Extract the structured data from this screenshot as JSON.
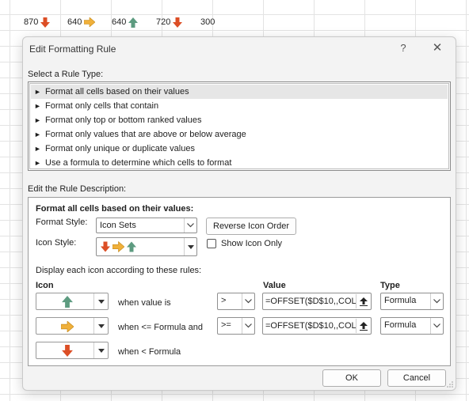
{
  "sheet": {
    "cells": [
      {
        "value": "870",
        "icon": "red-down-arrow-icon"
      },
      {
        "value": "640",
        "icon": "yellow-right-arrow-icon"
      },
      {
        "value": "640",
        "icon": "green-up-arrow-icon"
      },
      {
        "value": "720",
        "icon": "red-down-arrow-icon"
      },
      {
        "value": "300",
        "icon": ""
      }
    ]
  },
  "dialog": {
    "title": "Edit Formatting Rule",
    "help_label": "?",
    "close_label": "✕",
    "select_rule_type_label": "Select a Rule Type:",
    "rule_types": [
      "Format all cells based on their values",
      "Format only cells that contain",
      "Format only top or bottom ranked values",
      "Format only values that are above or below average",
      "Format only unique or duplicate values",
      "Use a formula to determine which cells to format"
    ],
    "selected_rule_index": 0,
    "edit_description_label": "Edit the Rule Description:",
    "desc_heading": "Format all cells based on their values:",
    "format_style_label": "Format Style:",
    "format_style_value": "Icon Sets",
    "reverse_icon_order_label": "Reverse Icon Order",
    "icon_style_label": "Icon Style:",
    "show_icon_only_label": "Show Icon Only",
    "show_icon_only_checked": false,
    "display_rules_label": "Display each icon according to these rules:",
    "col_icon": "Icon",
    "col_value": "Value",
    "col_type": "Type",
    "rows": [
      {
        "icon": "green-up-arrow-icon",
        "condition": "when value is",
        "operator": ">",
        "value": "=OFFSET($D$10,,COL",
        "type": "Formula"
      },
      {
        "icon": "yellow-right-arrow-icon",
        "condition": "when <= Formula and",
        "operator": ">=",
        "value": "=OFFSET($D$10,,COL",
        "type": "Formula"
      },
      {
        "icon": "red-down-arrow-icon",
        "condition": "when < Formula"
      }
    ],
    "ok_label": "OK",
    "cancel_label": "Cancel"
  },
  "colors": {
    "green_arrow": "#5d9b80",
    "yellow_arrow": "#f0b03a",
    "red_arrow": "#dc4e25"
  }
}
